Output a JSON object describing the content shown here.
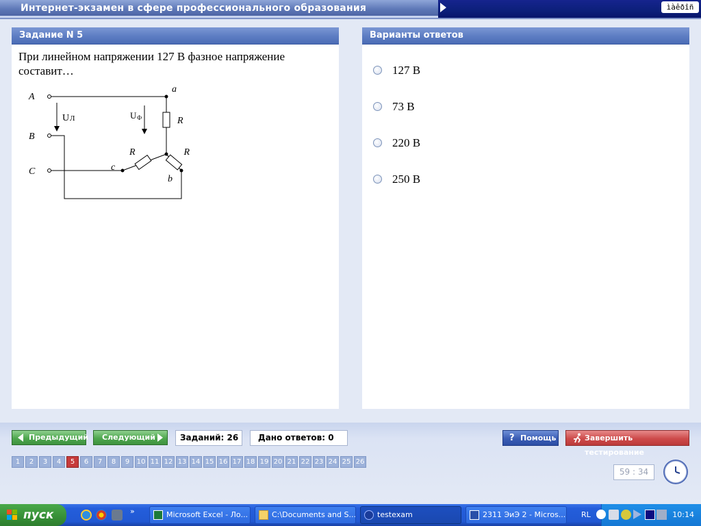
{
  "window": {
    "title": "Интернет-экзамен в сфере профессионального образования",
    "lang_box": "ìàêðîñ"
  },
  "question": {
    "header": "Задание N 5",
    "text": "При линейном напряжении 127 В фазное напряжение составит…",
    "diagram_labels": {
      "A": "A",
      "B": "B",
      "C": "C",
      "a": "a",
      "b": "b",
      "c": "c",
      "R": "R",
      "u_line": "U",
      "u_line_sub": "Л",
      "u_phase": "U",
      "u_phase_sub": "Ф"
    }
  },
  "answers": {
    "header": "Варианты ответов",
    "options": [
      "127 В",
      "73 В",
      "220 В",
      "250 В"
    ]
  },
  "navigation": {
    "prev_label": "Предыдущий",
    "next_label": "Следующий",
    "tasks_count": "Заданий: 26",
    "answers_given": "Дано ответов: 0",
    "help_label": "Помощь",
    "finish_label": "Завершить тестирование",
    "pages": [
      "1",
      "2",
      "3",
      "4",
      "5",
      "6",
      "7",
      "8",
      "9",
      "10",
      "11",
      "12",
      "13",
      "14",
      "15",
      "16",
      "17",
      "18",
      "19",
      "20",
      "21",
      "22",
      "23",
      "24",
      "25",
      "26"
    ],
    "current_page": "5",
    "timer": "59 : 34"
  },
  "taskbar": {
    "start_label": "пуск",
    "tasks": [
      "Microsoft Excel - Ло...",
      "C:\\Documents and S...",
      "testexam",
      "2311 ЭиЭ 2 - Micros..."
    ],
    "active_task": "testexam",
    "lang": "RL",
    "time": "10:14"
  }
}
